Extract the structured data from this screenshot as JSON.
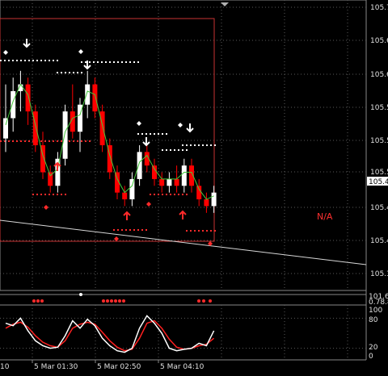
{
  "colors": {
    "background": "#000000",
    "grid": "#5a5a5a",
    "bull": "#ffffff",
    "bear": "#ff0000",
    "wick_line": "#46c83c",
    "dots": "#ffffff",
    "red_dots": "#ff2a2a",
    "box": "#c83232",
    "trend": "#d8d8d8",
    "osc_main": "#ffffff",
    "osc_signal": "#ff2020",
    "na_text": "#ff3030",
    "price_tag_bg": "#ffffff"
  },
  "main_chart": {
    "price_labels": [
      "105.7",
      "105.6",
      "105.6",
      "105.5",
      "105.5",
      "105.5",
      "105.4",
      "105.4",
      "105.4",
      "105.3"
    ],
    "current_price_label": "105.4",
    "na_label": "N/A"
  },
  "indicator_strip": {
    "labels": [
      "101.6",
      "0.78.8"
    ]
  },
  "oscillator": {
    "labels": [
      "100",
      "80",
      "20",
      "0"
    ]
  },
  "time_axis": {
    "labels": [
      "10",
      "5 Mar 01:30",
      "5 Mar 02:50",
      "5 Mar 04:10"
    ]
  },
  "chart_data": {
    "type": "candlestick",
    "title": "",
    "candles": [
      {
        "o": 105.52,
        "h": 105.6,
        "l": 105.5,
        "c": 105.55
      },
      {
        "o": 105.55,
        "h": 105.61,
        "l": 105.53,
        "c": 105.59
      },
      {
        "o": 105.59,
        "h": 105.62,
        "l": 105.56,
        "c": 105.6
      },
      {
        "o": 105.6,
        "h": 105.61,
        "l": 105.54,
        "c": 105.56
      },
      {
        "o": 105.56,
        "h": 105.57,
        "l": 105.5,
        "c": 105.51
      },
      {
        "o": 105.51,
        "h": 105.53,
        "l": 105.46,
        "c": 105.47
      },
      {
        "o": 105.47,
        "h": 105.48,
        "l": 105.44,
        "c": 105.45
      },
      {
        "o": 105.45,
        "h": 105.5,
        "l": 105.44,
        "c": 105.49
      },
      {
        "o": 105.49,
        "h": 105.57,
        "l": 105.48,
        "c": 105.56
      },
      {
        "o": 105.56,
        "h": 105.6,
        "l": 105.52,
        "c": 105.53
      },
      {
        "o": 105.53,
        "h": 105.58,
        "l": 105.5,
        "c": 105.57
      },
      {
        "o": 105.57,
        "h": 105.62,
        "l": 105.55,
        "c": 105.6
      },
      {
        "o": 105.6,
        "h": 105.61,
        "l": 105.55,
        "c": 105.56
      },
      {
        "o": 105.56,
        "h": 105.57,
        "l": 105.5,
        "c": 105.51
      },
      {
        "o": 105.51,
        "h": 105.52,
        "l": 105.46,
        "c": 105.47
      },
      {
        "o": 105.47,
        "h": 105.48,
        "l": 105.43,
        "c": 105.44
      },
      {
        "o": 105.44,
        "h": 105.45,
        "l": 105.42,
        "c": 105.43
      },
      {
        "o": 105.43,
        "h": 105.47,
        "l": 105.42,
        "c": 105.46
      },
      {
        "o": 105.46,
        "h": 105.51,
        "l": 105.45,
        "c": 105.5
      },
      {
        "o": 105.5,
        "h": 105.51,
        "l": 105.47,
        "c": 105.48
      },
      {
        "o": 105.48,
        "h": 105.49,
        "l": 105.45,
        "c": 105.46
      },
      {
        "o": 105.46,
        "h": 105.47,
        "l": 105.44,
        "c": 105.45
      },
      {
        "o": 105.45,
        "h": 105.47,
        "l": 105.44,
        "c": 105.46
      },
      {
        "o": 105.46,
        "h": 105.48,
        "l": 105.44,
        "c": 105.45
      },
      {
        "o": 105.45,
        "h": 105.49,
        "l": 105.44,
        "c": 105.48
      },
      {
        "o": 105.48,
        "h": 105.49,
        "l": 105.44,
        "c": 105.45
      },
      {
        "o": 105.45,
        "h": 105.46,
        "l": 105.42,
        "c": 105.43
      },
      {
        "o": 105.43,
        "h": 105.44,
        "l": 105.41,
        "c": 105.42
      },
      {
        "o": 105.42,
        "h": 105.45,
        "l": 105.41,
        "c": 105.44
      }
    ],
    "y_range": [
      105.3,
      105.72
    ],
    "trend_line": {
      "start": 105.43,
      "end": 105.37
    },
    "oscillator_series": [
      {
        "values": [
          70,
          65,
          80,
          55,
          35,
          25,
          20,
          22,
          45,
          75,
          60,
          78,
          65,
          40,
          25,
          15,
          12,
          20,
          60,
          85,
          70,
          50,
          20,
          15,
          18,
          20,
          30,
          25,
          55
        ]
      },
      {
        "values": [
          60,
          68,
          72,
          62,
          45,
          32,
          25,
          22,
          35,
          60,
          68,
          72,
          68,
          52,
          35,
          22,
          15,
          18,
          40,
          70,
          75,
          60,
          38,
          22,
          18,
          20,
          25,
          28,
          40
        ]
      }
    ],
    "oscillator_range": [
      0,
      100
    ]
  }
}
